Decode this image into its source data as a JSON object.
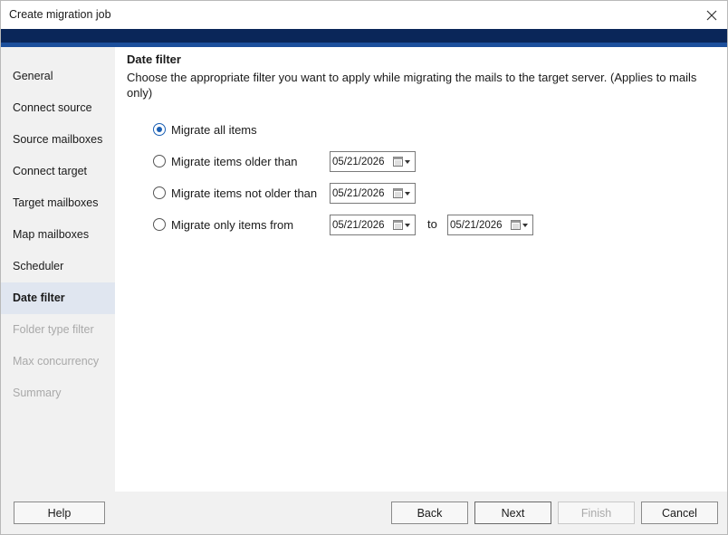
{
  "window": {
    "title": "Create migration job"
  },
  "sidebar": {
    "items": [
      {
        "label": "General",
        "state": "normal"
      },
      {
        "label": "Connect source",
        "state": "normal"
      },
      {
        "label": "Source mailboxes",
        "state": "normal"
      },
      {
        "label": "Connect target",
        "state": "normal"
      },
      {
        "label": "Target mailboxes",
        "state": "normal"
      },
      {
        "label": "Map mailboxes",
        "state": "normal"
      },
      {
        "label": "Scheduler",
        "state": "normal"
      },
      {
        "label": "Date filter",
        "state": "active"
      },
      {
        "label": "Folder type filter",
        "state": "disabled"
      },
      {
        "label": "Max concurrency",
        "state": "disabled"
      },
      {
        "label": "Summary",
        "state": "disabled"
      }
    ]
  },
  "main": {
    "title": "Date filter",
    "description": "Choose the appropriate filter you want to apply while migrating the mails to the target server. (Applies to mails only)",
    "options": [
      {
        "label": "Migrate all items",
        "checked": true
      },
      {
        "label": "Migrate items older than",
        "checked": false,
        "date": "05/21/2026"
      },
      {
        "label": "Migrate items not older than",
        "checked": false,
        "date": "05/21/2026"
      },
      {
        "label": "Migrate only items from",
        "checked": false,
        "date_from": "05/21/2026",
        "to_label": "to",
        "date_to": "05/21/2026"
      }
    ]
  },
  "footer": {
    "help": "Help",
    "back": "Back",
    "next": "Next",
    "finish": "Finish",
    "cancel": "Cancel"
  },
  "colors": {
    "banner": "#0a2659",
    "banner_stripe": "#1c4f9c",
    "accent": "#1a5fb4",
    "sidebar_bg": "#f1f1f1",
    "active_item_bg": "#e0e6f0"
  }
}
